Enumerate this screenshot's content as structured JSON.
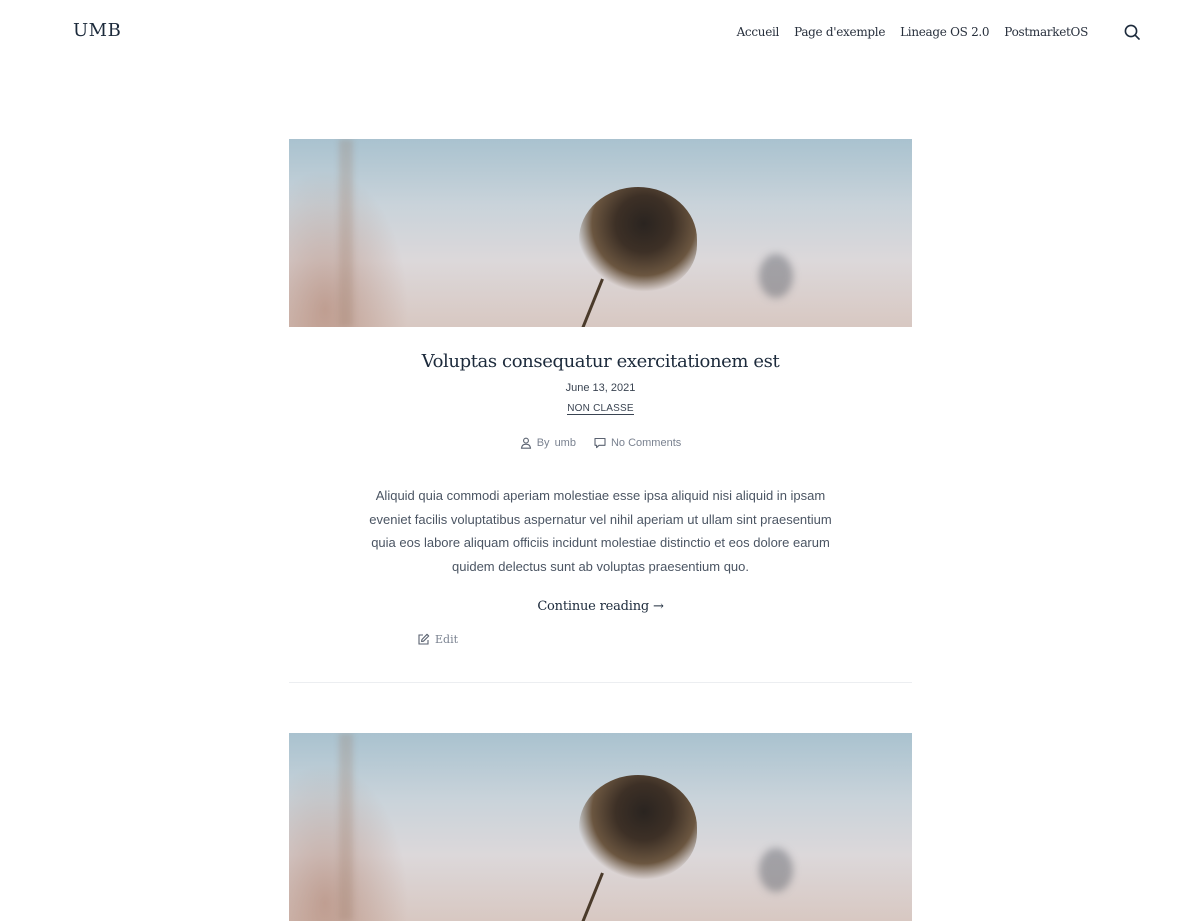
{
  "site": {
    "title": "UMB"
  },
  "nav": {
    "items": [
      {
        "label": "Accueil"
      },
      {
        "label": "Page d'exemple"
      },
      {
        "label": "Lineage OS 2.0"
      },
      {
        "label": "PostmarketOS"
      }
    ],
    "search_icon": "search-icon"
  },
  "posts": [
    {
      "title": "Voluptas consequatur exercitationem est",
      "date": "June 13, 2021",
      "category": "NON CLASSE",
      "author_prefix": "By",
      "author": "umb",
      "comments": "No Comments",
      "excerpt": "Aliquid quia commodi aperiam molestiae esse ipsa aliquid nisi aliquid in ipsam eveniet facilis voluptatibus aspernatur vel nihil aperiam ut ullam sint praesentium quia eos labore aliquam officiis incidunt molestiae distinctio et eos dolore earum quidem delectus sunt ab voluptas praesentium quo.",
      "continue_label": "Continue reading →",
      "edit_label": "Edit"
    }
  ],
  "colors": {
    "text": "#28303d",
    "heading": "#1c2a3b",
    "muted": "#7a8290",
    "background": "#ffffff"
  }
}
